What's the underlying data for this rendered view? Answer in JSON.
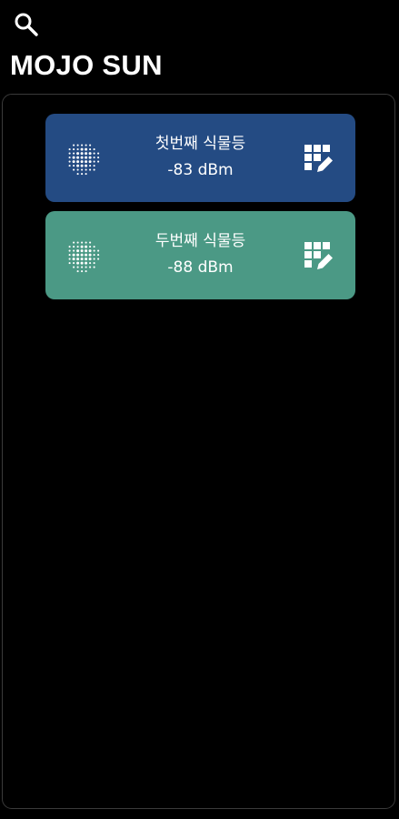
{
  "app": {
    "title": "MOJO SUN"
  },
  "toolbar": {
    "search_icon": "search-icon"
  },
  "devices": [
    {
      "name": "첫번째 식물등",
      "signal": "-83 dBm",
      "color": "#244b83",
      "light_icon": "dot-grid-light-icon",
      "edit_icon": "grid-edit-icon"
    },
    {
      "name": "두번째 식물등",
      "signal": "-88 dBm",
      "color": "#4b9985",
      "light_icon": "dot-grid-light-icon",
      "edit_icon": "grid-edit-icon"
    }
  ],
  "colors": {
    "background": "#000000",
    "panel_border": "#3a3a3a",
    "text": "#ffffff"
  }
}
